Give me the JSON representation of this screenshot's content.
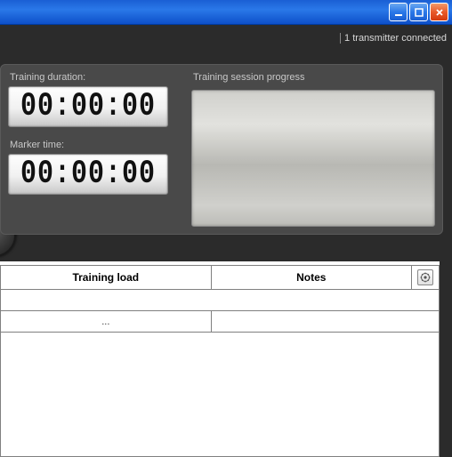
{
  "status": {
    "text": "1 transmitter connected"
  },
  "duration": {
    "label": "Training duration:",
    "value": "00:00:00"
  },
  "marker": {
    "label": "Marker time:",
    "value": "00:00:00"
  },
  "progress": {
    "label": "Training session progress"
  },
  "table": {
    "col_load": "Training load",
    "col_notes": "Notes",
    "row1_load": "...",
    "row1_notes": ""
  }
}
